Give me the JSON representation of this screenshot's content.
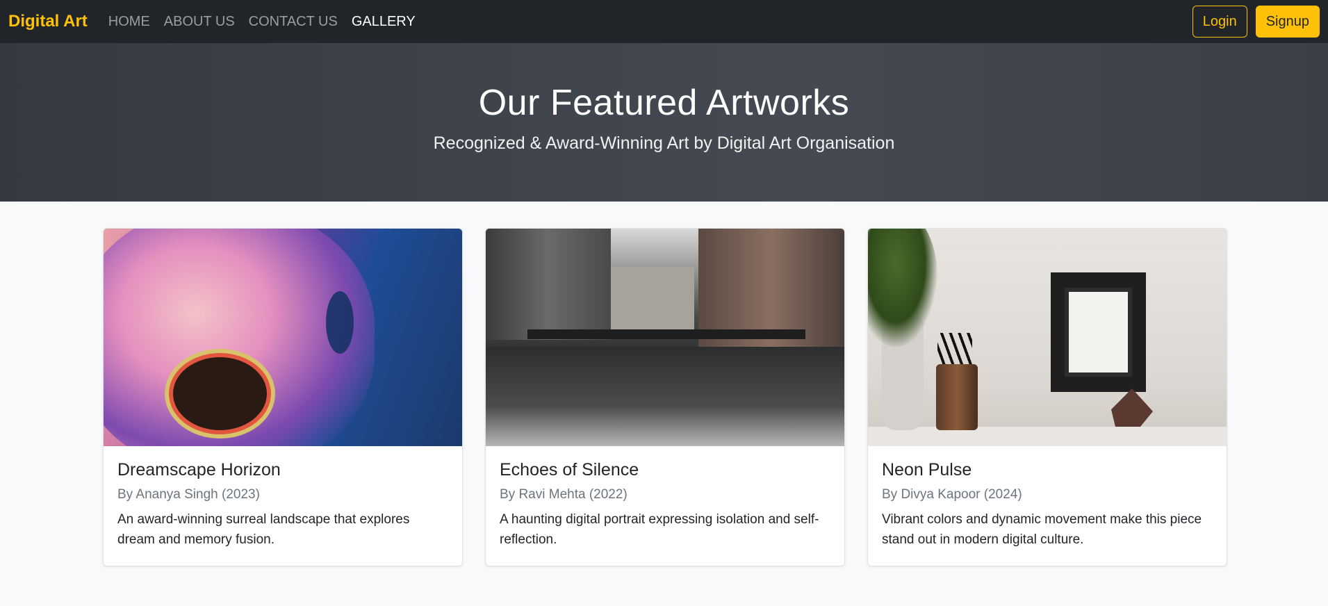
{
  "nav": {
    "brand": "Digital Art",
    "links": [
      "HOME",
      "ABOUT US",
      "CONTACT US",
      "GALLERY"
    ],
    "active": "GALLERY",
    "login_label": "Login",
    "signup_label": "Signup"
  },
  "hero": {
    "title": "Our Featured Artworks",
    "subtitle": "Recognized & Award-Winning Art by Digital Art Organisation"
  },
  "cards": [
    {
      "title": "Dreamscape Horizon",
      "meta": "By Ananya Singh (2023)",
      "text": "An award-winning surreal landscape that explores dream and memory fusion."
    },
    {
      "title": "Echoes of Silence",
      "meta": "By Ravi Mehta (2022)",
      "text": "A haunting digital portrait expressing isolation and self-reflection."
    },
    {
      "title": "Neon Pulse",
      "meta": "By Divya Kapoor (2024)",
      "text": "Vibrant colors and dynamic movement make this piece stand out in modern digital culture."
    }
  ],
  "colors": {
    "accent": "#ffc107",
    "navbar_bg": "#212529",
    "hero_bg": "#3f444b",
    "page_bg": "#f8f9fa"
  }
}
